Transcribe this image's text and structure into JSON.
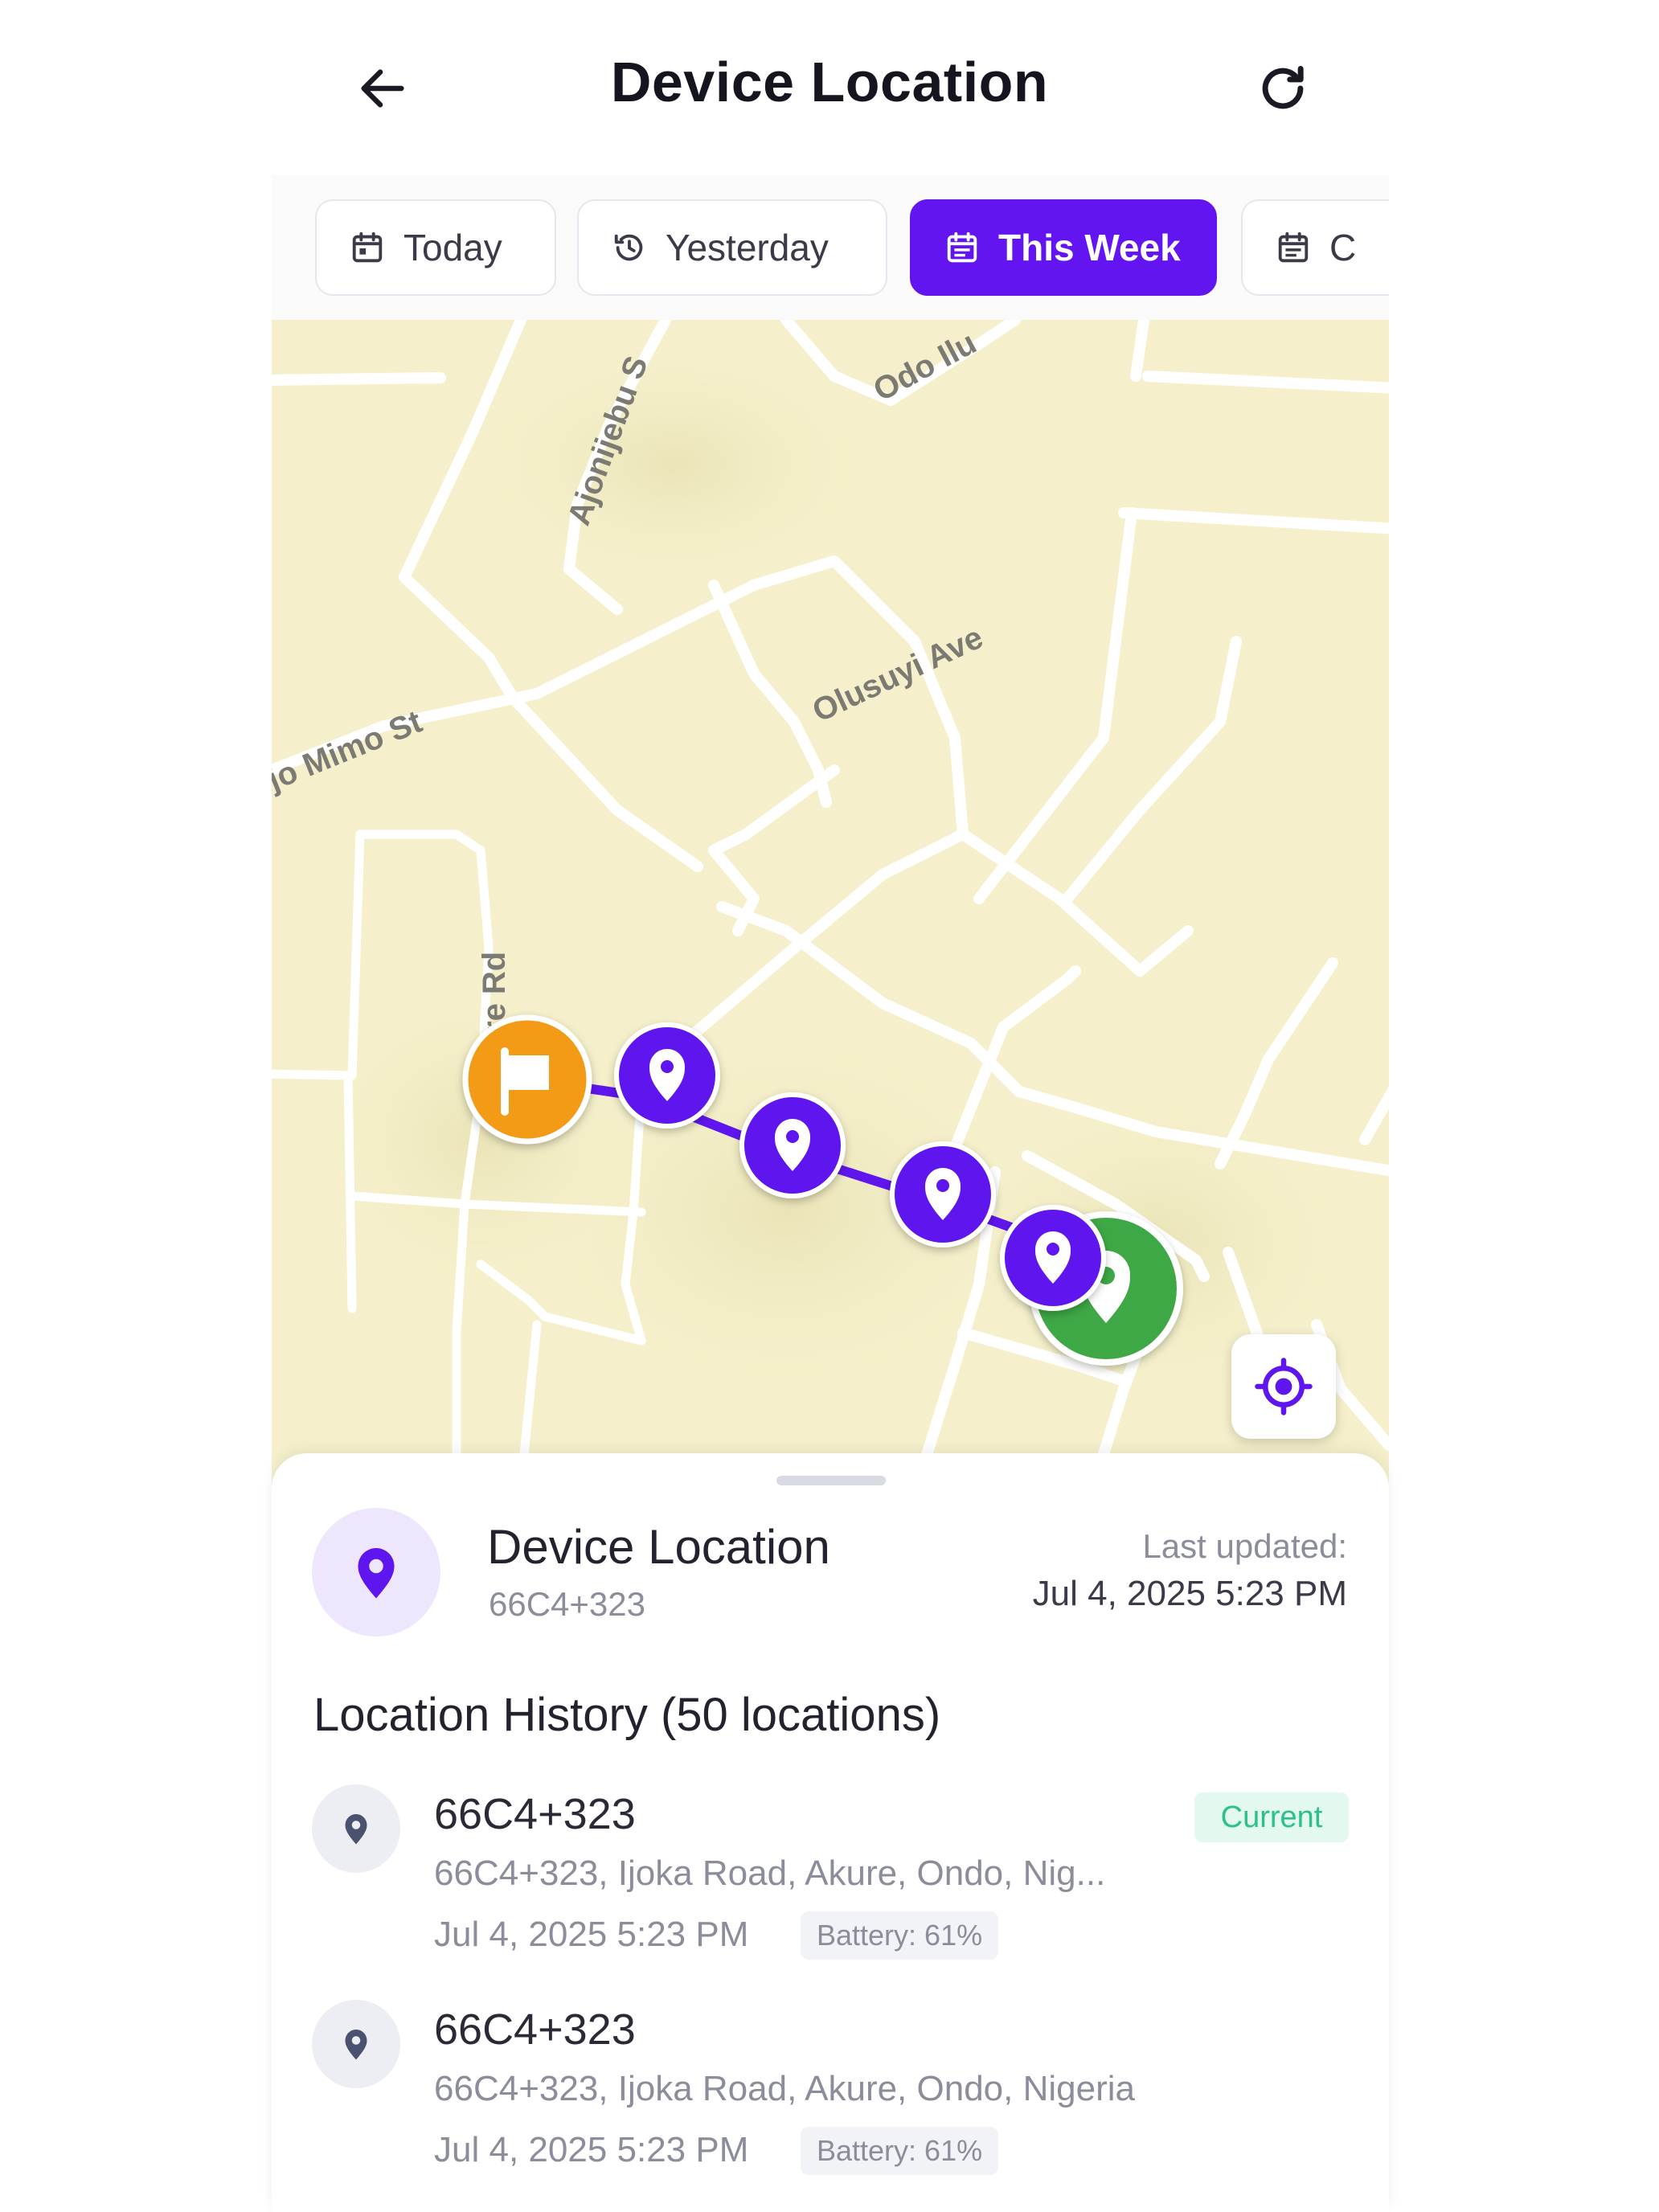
{
  "header": {
    "title": "Device Location",
    "back_icon": "arrow-left-icon",
    "refresh_icon": "refresh-icon"
  },
  "filters": {
    "chips": [
      {
        "label": "Today",
        "icon": "calendar-icon",
        "active": false
      },
      {
        "label": "Yesterday",
        "icon": "history-icon",
        "active": false
      },
      {
        "label": "This Week",
        "icon": "calendar-icon",
        "active": true
      },
      {
        "label": "C",
        "icon": "calendar-icon",
        "active": false
      }
    ]
  },
  "map": {
    "streets": [
      "Ajonijebu S",
      "Odo Ilu",
      "Olusuyi Ave",
      "Ijo Mimo St",
      "re Rd"
    ],
    "colors": {
      "start_marker": "#f39a12",
      "waypoint": "#5f15ee",
      "current_marker": "#3ea845",
      "route": "#5f15ee",
      "land": "#f5f0cb",
      "road": "#ffffff"
    }
  },
  "device": {
    "title": "Device Location",
    "code": "66C4+323",
    "last_updated_label": "Last updated:",
    "last_updated": "Jul 4, 2025 5:23 PM"
  },
  "history": {
    "title": "Location History (50 locations)",
    "items": [
      {
        "title": "66C4+323",
        "address": "66C4+323, Ijoka Road, Akure, Ondo, Nig...",
        "time": "Jul 4, 2025 5:23 PM",
        "battery": "Battery: 61%",
        "badge": "Current"
      },
      {
        "title": "66C4+323",
        "address": "66C4+323, Ijoka Road, Akure, Ondo, Nigeria",
        "time": "Jul 4, 2025 5:23 PM",
        "battery": "Battery: 61%"
      }
    ]
  }
}
